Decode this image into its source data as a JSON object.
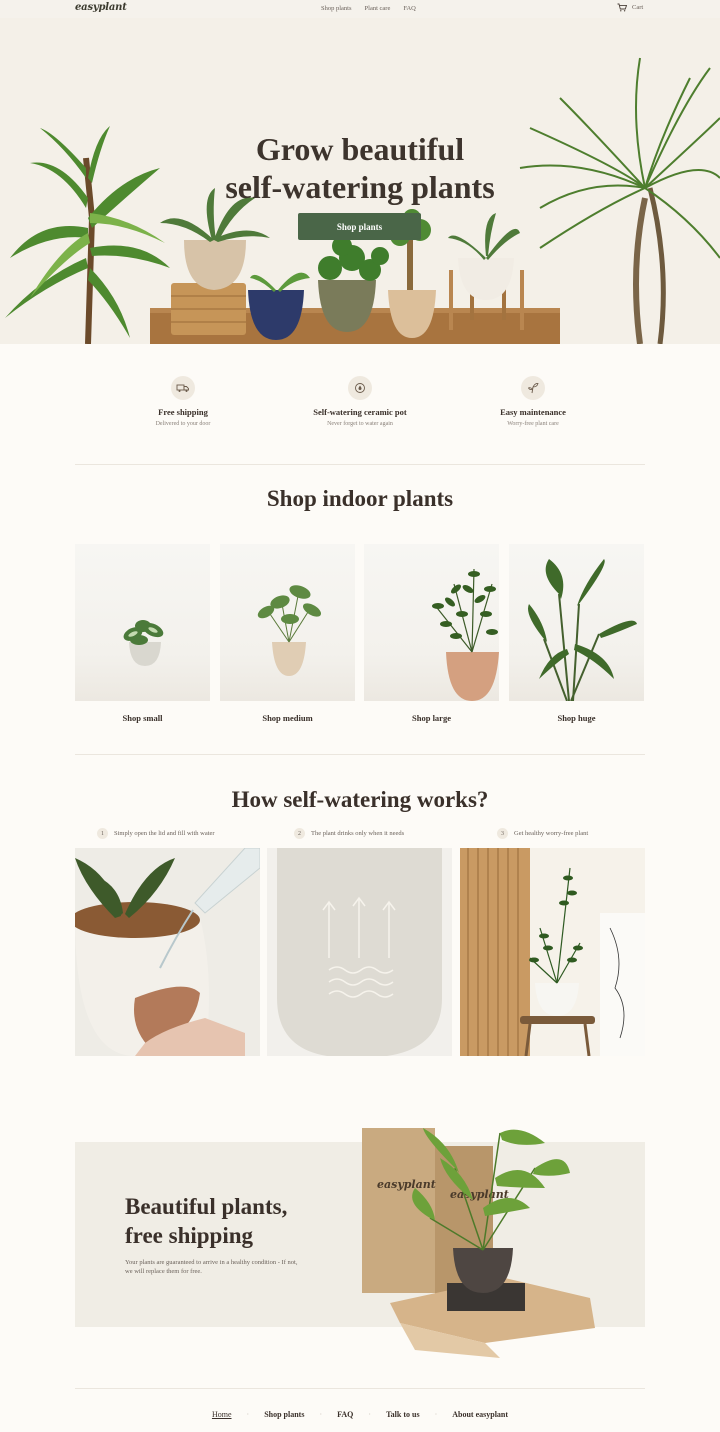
{
  "nav": {
    "logo": "easyplant",
    "links": [
      "Shop plants",
      "Plant care",
      "FAQ"
    ],
    "cart_label": "Cart"
  },
  "hero": {
    "title_line1": "Grow beautiful",
    "title_line2": "self-watering plants",
    "cta": "Shop plants"
  },
  "features": [
    {
      "icon": "truck-icon",
      "title": "Free shipping",
      "subtitle": "Delivered to your door"
    },
    {
      "icon": "water-cycle-icon",
      "title": "Self-watering ceramic pot",
      "subtitle": "Never forget to water again"
    },
    {
      "icon": "sprout-icon",
      "title": "Easy maintenance",
      "subtitle": "Worry-free plant care"
    }
  ],
  "shop_section": {
    "title": "Shop indoor plants",
    "cards": [
      {
        "label": "Shop small"
      },
      {
        "label": "Shop medium"
      },
      {
        "label": "Shop large"
      },
      {
        "label": "Shop huge"
      }
    ]
  },
  "how_section": {
    "title": "How self-watering works?",
    "steps": [
      {
        "num": "1",
        "text": "Simply open the lid and fill with water"
      },
      {
        "num": "2",
        "text": "The plant drinks only when it needs"
      },
      {
        "num": "3",
        "text": "Get healthy worry-free plant"
      }
    ]
  },
  "promo": {
    "title_line1": "Beautiful plants,",
    "title_line2": "free shipping",
    "text": "Your plants are guaranteed to arrive in a healthy condition - If not, we will replace them for free.",
    "box_brand": "easyplant"
  },
  "footer": {
    "links": [
      "Home",
      "Shop plants",
      "FAQ",
      "Talk to us",
      "About easyplant"
    ]
  },
  "colors": {
    "accent": "#4a6648",
    "background": "#fdfbf7",
    "hero_bg": "#f4f0e8",
    "text": "#3a302a"
  }
}
